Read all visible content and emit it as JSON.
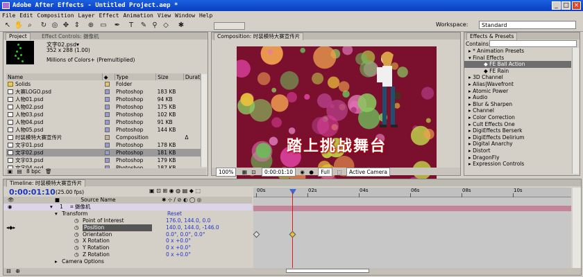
{
  "window": {
    "title": "Adobe After Effects - Untitled Project.aep *"
  },
  "menu": [
    "File",
    "Edit",
    "Composition",
    "Layer",
    "Effect",
    "Animation",
    "View",
    "Window",
    "Help"
  ],
  "workspace": {
    "label": "Workspace:",
    "value": "Standard"
  },
  "project": {
    "tab_project": "Project",
    "tab_effect_controls": "Effect Controls: 摄像机",
    "selected_name": "文字02.psd▾",
    "selected_dims": "352 x 288 (1.00)",
    "selected_colors": "Millions of Colors+ (Premultiplied)",
    "columns": {
      "name": "Name",
      "type": "Type",
      "size": "Size",
      "duration": "Durat"
    },
    "items": [
      {
        "name": "Solids",
        "type": "Folder",
        "size": "",
        "dur": "",
        "swatch": "#e8c860",
        "kind": "folder"
      },
      {
        "name": "大赛LOGO.psd",
        "type": "Photoshop",
        "size": "183 KB",
        "dur": "",
        "swatch": "#9a9acf",
        "kind": "psd"
      },
      {
        "name": "人物01.psd",
        "type": "Photoshop",
        "size": "94 KB",
        "dur": "",
        "swatch": "#9a9acf",
        "kind": "psd"
      },
      {
        "name": "人物02.psd",
        "type": "Photoshop",
        "size": "175 KB",
        "dur": "",
        "swatch": "#9a9acf",
        "kind": "psd"
      },
      {
        "name": "人物03.psd",
        "type": "Photoshop",
        "size": "102 KB",
        "dur": "",
        "swatch": "#9a9acf",
        "kind": "psd"
      },
      {
        "name": "人物04.psd",
        "type": "Photoshop",
        "size": "91 KB",
        "dur": "",
        "swatch": "#9a9acf",
        "kind": "psd"
      },
      {
        "name": "人物05.psd",
        "type": "Photoshop",
        "size": "144 KB",
        "dur": "",
        "swatch": "#9a9acf",
        "kind": "psd"
      },
      {
        "name": "时装模特大赛宣传片",
        "type": "Composition",
        "size": "",
        "dur": "Δ",
        "swatch": "#c8b090",
        "kind": "comp"
      },
      {
        "name": "文字01.psd",
        "type": "Photoshop",
        "size": "178 KB",
        "dur": "",
        "swatch": "#9a9acf",
        "kind": "psd"
      },
      {
        "name": "文字02.psd",
        "type": "Photoshop",
        "size": "181 KB",
        "dur": "",
        "swatch": "#9a9acf",
        "kind": "psd",
        "selected": true
      },
      {
        "name": "文字03.psd",
        "type": "Photoshop",
        "size": "179 KB",
        "dur": "",
        "swatch": "#9a9acf",
        "kind": "psd"
      },
      {
        "name": "文字04.psd",
        "type": "Photoshop",
        "size": "187 KB",
        "dur": "",
        "swatch": "#9a9acf",
        "kind": "psd"
      }
    ],
    "bpc": "8 bpc"
  },
  "composition": {
    "tab": "Composition: 时装模特大赛宣传片",
    "overlay_text": "踏上挑战舞台",
    "zoom": "100%",
    "timecode": "0:00:01:10",
    "resolution": "Full",
    "camera": "Active Camera"
  },
  "effects": {
    "tab": "Effects & Presets",
    "contains_label": "Contains:",
    "items": [
      {
        "label": "* Animation Presets",
        "level": 0
      },
      {
        "label": "Final Effects",
        "level": 0,
        "open": true
      },
      {
        "label": "FE Ball Action",
        "level": 1,
        "highlight": true
      },
      {
        "label": "FE Rain",
        "level": 1
      },
      {
        "label": "3D Channel",
        "level": 0
      },
      {
        "label": "Alias|Wavefront",
        "level": 0
      },
      {
        "label": "Atomic Power",
        "level": 0
      },
      {
        "label": "Audio",
        "level": 0
      },
      {
        "label": "Blur & Sharpen",
        "level": 0
      },
      {
        "label": "Channel",
        "level": 0
      },
      {
        "label": "Color Correction",
        "level": 0
      },
      {
        "label": "Cult Effects One",
        "level": 0
      },
      {
        "label": "DigiEffects Berserk",
        "level": 0
      },
      {
        "label": "DigiEffects Delirium",
        "level": 0
      },
      {
        "label": "Digital Anarchy",
        "level": 0
      },
      {
        "label": "Distort",
        "level": 0
      },
      {
        "label": "DragonFly",
        "level": 0
      },
      {
        "label": "Expression Controls",
        "level": 0
      }
    ]
  },
  "timeline": {
    "tab": "Timeline: 时装模特大赛宣传片",
    "time": "0:00:01:10",
    "fps": "(25.00 fps)",
    "source_name_header": "Source Name",
    "layer_num": "1",
    "layer_name": "摄像机",
    "transform": "Transform",
    "reset": "Reset",
    "props": [
      {
        "name": "Point of Interest",
        "value": "176.0, 144.0, 0.0"
      },
      {
        "name": "Position",
        "value": "140.0, 144.0, -146.0",
        "selected": true
      },
      {
        "name": "Orientation",
        "value": "0.0°, 0.0°, 0.0°"
      },
      {
        "name": "X Rotation",
        "value": "0 x +0.0°"
      },
      {
        "name": "Y Rotation",
        "value": "0 x +0.0°"
      },
      {
        "name": "Z Rotation",
        "value": "0 x +0.0°"
      }
    ],
    "camera_options": "Camera Options",
    "ruler": [
      "00s",
      "02s",
      "04s",
      "06s",
      "08s",
      "10s"
    ]
  }
}
